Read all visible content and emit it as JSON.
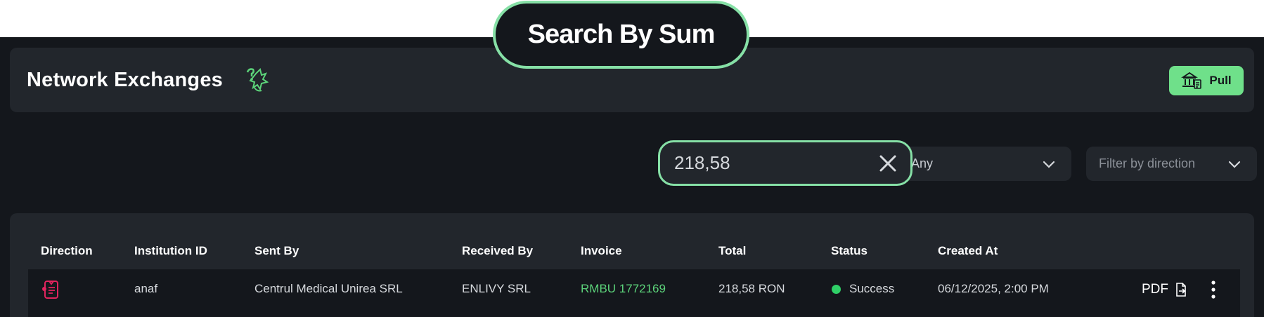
{
  "overlay": {
    "title": "Search By Sum"
  },
  "header": {
    "title": "Network Exchanges",
    "mascot_icon": "mascot-icon",
    "pull_label": "Pull",
    "pull_icon": "bank-transfer-icon"
  },
  "filters": {
    "search_value": "218,58",
    "status_value": "Any",
    "direction_placeholder": "Filter by direction"
  },
  "table": {
    "columns": [
      "Direction",
      "Institution ID",
      "Sent By",
      "Received By",
      "Invoice",
      "Total",
      "Status",
      "Created At"
    ],
    "rows": [
      {
        "direction_icon": "inbound-document-icon",
        "institution_id": "anaf",
        "sent_by": "Centrul Medical Unirea SRL",
        "received_by": "ENLIVY SRL",
        "invoice": "RMBU 1772169",
        "total": "218,58 RON",
        "status": "Success",
        "created_at": "06/12/2025, 2:00 PM",
        "pdf_label": "PDF"
      }
    ]
  },
  "colors": {
    "accent": "#6fe08a",
    "background": "#14171c",
    "card": "#22262c",
    "success": "#2fd067",
    "direction_icon": "#e0245e"
  }
}
